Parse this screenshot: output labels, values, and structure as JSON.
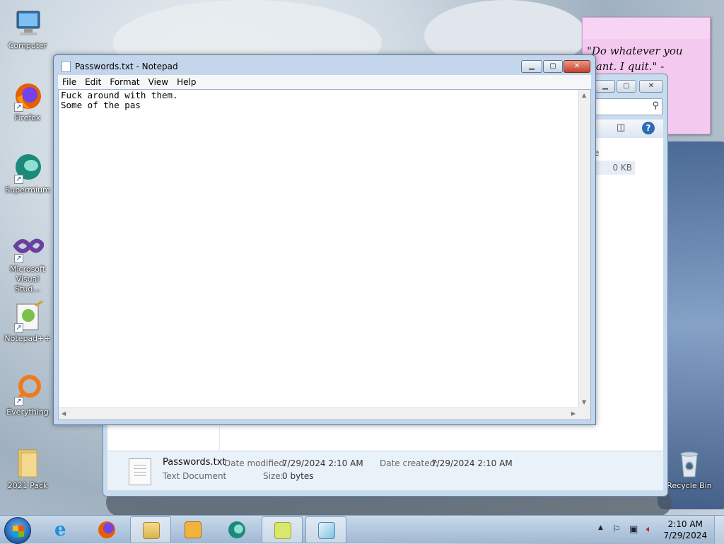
{
  "desktop": {
    "icons": [
      {
        "label": "Computer",
        "icon": "computer-icon"
      },
      {
        "label": "Firefox",
        "icon": "firefox-icon"
      },
      {
        "label": "Supermium",
        "icon": "supermium-icon"
      },
      {
        "label": "Microsoft Visual Stud...",
        "icon": "visual-studio-icon"
      },
      {
        "label": "Notepad++",
        "icon": "notepadpp-icon"
      },
      {
        "label": "Everything",
        "icon": "everything-icon"
      },
      {
        "label": "2021 Pack",
        "icon": "folder-icon"
      },
      {
        "label": "Recycle Bin",
        "icon": "recycle-bin-icon"
      }
    ],
    "sticky_note": {
      "text": "\"Do whatever you want. I quit.\" -"
    }
  },
  "explorer": {
    "partial_header": "e",
    "partial_size": "0 KB",
    "details": {
      "file_name": "Passwords.txt",
      "file_type": "Text Document",
      "date_modified_label": "Date modified:",
      "date_modified": "7/29/2024 2:10 AM",
      "date_created_label": "Date created:",
      "date_created": "7/29/2024 2:10 AM",
      "size_label": "Size:",
      "size": "0 bytes"
    }
  },
  "notepad": {
    "title": "Passwords.txt - Notepad",
    "menu": [
      "File",
      "Edit",
      "Format",
      "View",
      "Help"
    ],
    "content": "Fuck around with them.\nSome of the pas"
  },
  "taskbar": {
    "time": "2:10 AM",
    "date": "7/29/2024",
    "colors": {
      "accent": "#1d5ea8",
      "close": "#c6402b"
    }
  }
}
